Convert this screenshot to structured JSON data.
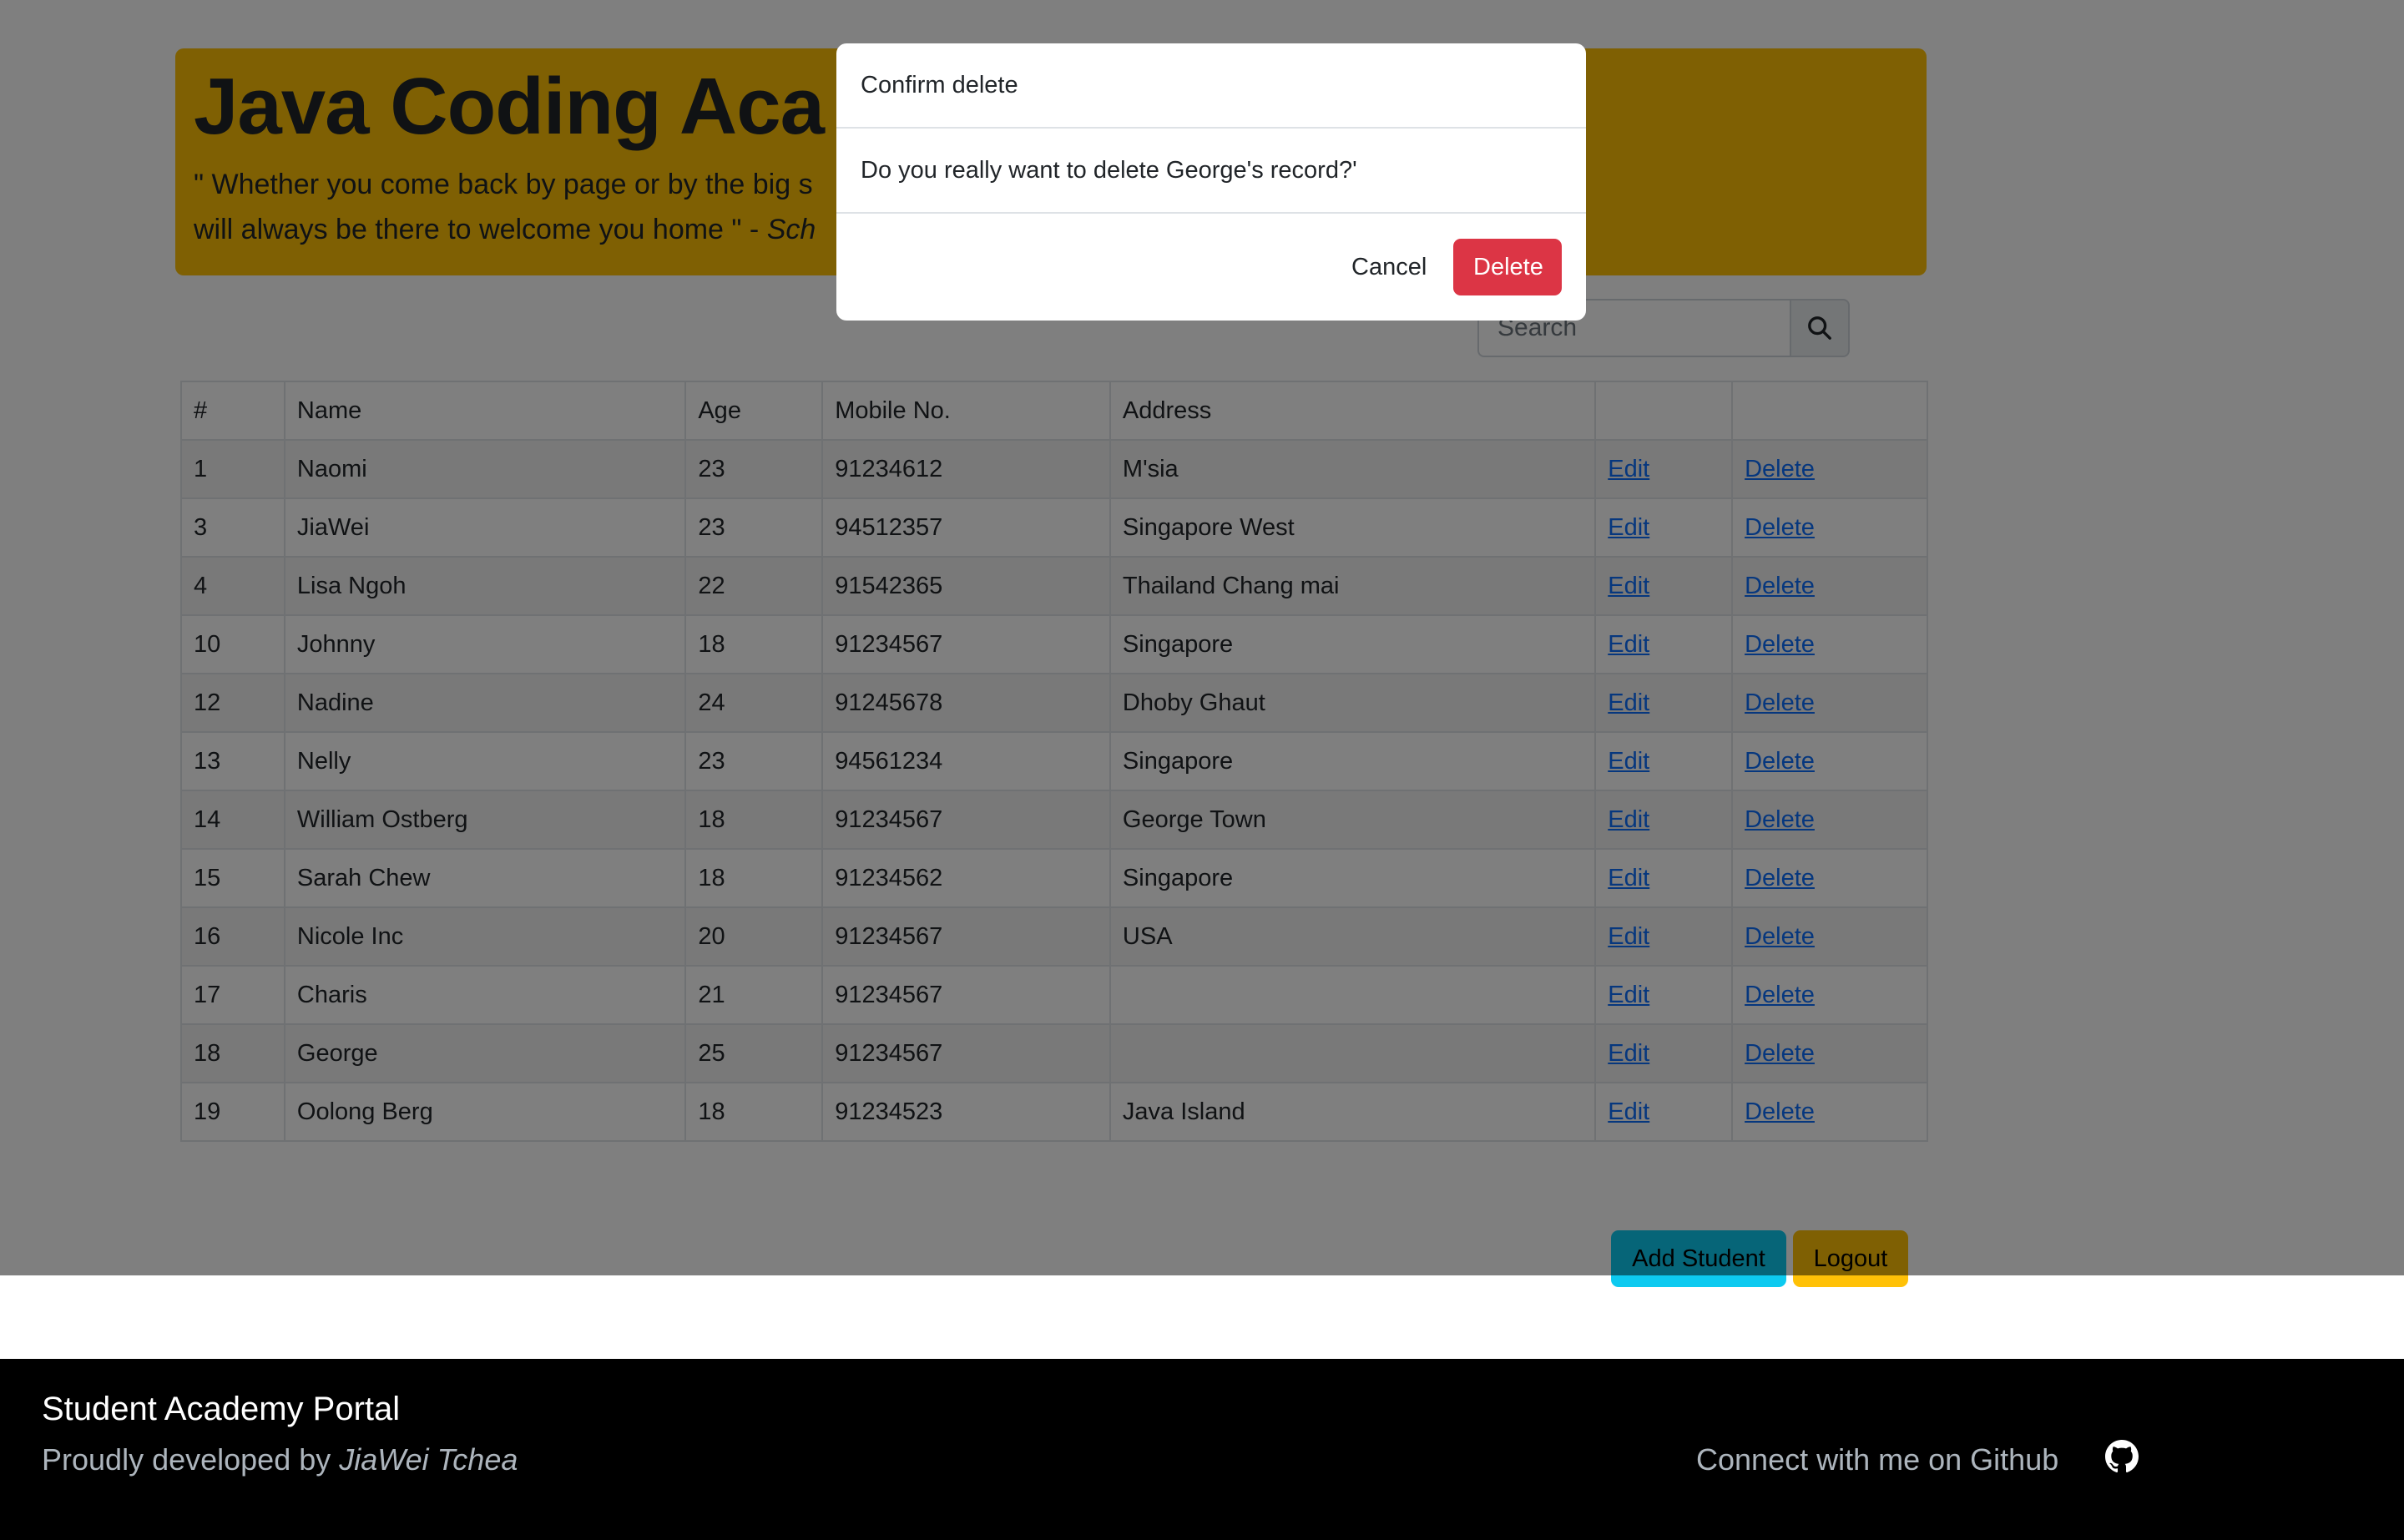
{
  "header": {
    "title": "Java Coding Aca",
    "quote_line1": "\" Whether you come back by page or by the big s",
    "quote_line2": "will always be there to welcome you home \" - ",
    "quote_author": "Sch"
  },
  "search": {
    "placeholder": "Search",
    "icon": "search-icon"
  },
  "table": {
    "columns": [
      "#",
      "Name",
      "Age",
      "Mobile No.",
      "Address",
      "",
      ""
    ],
    "rows": [
      {
        "id": "1",
        "name": "Naomi",
        "age": "23",
        "mobile": "91234612",
        "address": "M'sia",
        "edit": "Edit",
        "delete": "Delete"
      },
      {
        "id": "3",
        "name": "JiaWei",
        "age": "23",
        "mobile": "94512357",
        "address": "Singapore West",
        "edit": "Edit",
        "delete": "Delete"
      },
      {
        "id": "4",
        "name": "Lisa Ngoh",
        "age": "22",
        "mobile": "91542365",
        "address": "Thailand Chang mai",
        "edit": "Edit",
        "delete": "Delete"
      },
      {
        "id": "10",
        "name": "Johnny",
        "age": "18",
        "mobile": "91234567",
        "address": "Singapore",
        "edit": "Edit",
        "delete": "Delete"
      },
      {
        "id": "12",
        "name": "Nadine",
        "age": "24",
        "mobile": "91245678",
        "address": "Dhoby Ghaut",
        "edit": "Edit",
        "delete": "Delete"
      },
      {
        "id": "13",
        "name": "Nelly",
        "age": "23",
        "mobile": "94561234",
        "address": "Singapore",
        "edit": "Edit",
        "delete": "Delete"
      },
      {
        "id": "14",
        "name": "William Ostberg",
        "age": "18",
        "mobile": "91234567",
        "address": "George Town",
        "edit": "Edit",
        "delete": "Delete"
      },
      {
        "id": "15",
        "name": "Sarah Chew",
        "age": "18",
        "mobile": "91234562",
        "address": "Singapore",
        "edit": "Edit",
        "delete": "Delete"
      },
      {
        "id": "16",
        "name": "Nicole Inc",
        "age": "20",
        "mobile": "91234567",
        "address": "USA",
        "edit": "Edit",
        "delete": "Delete"
      },
      {
        "id": "17",
        "name": "Charis",
        "age": "21",
        "mobile": "91234567",
        "address": "",
        "edit": "Edit",
        "delete": "Delete"
      },
      {
        "id": "18",
        "name": "George",
        "age": "25",
        "mobile": "91234567",
        "address": "",
        "edit": "Edit",
        "delete": "Delete"
      },
      {
        "id": "19",
        "name": "Oolong Berg",
        "age": "18",
        "mobile": "91234523",
        "address": "Java Island",
        "edit": "Edit",
        "delete": "Delete"
      }
    ]
  },
  "actions": {
    "add_label": "Add Student",
    "logout_label": "Logout"
  },
  "footer": {
    "title": "Student Academy Portal",
    "developed_prefix": "Proudly developed by ",
    "developer": "JiaWei Tchea",
    "connect": "Connect with me on Github",
    "icon": "github-icon"
  },
  "modal": {
    "title": "Confirm delete",
    "message": "Do you really want to delete George's record?'",
    "cancel_label": "Cancel",
    "delete_label": "Delete"
  },
  "colors": {
    "jumbotron": "#ffc107",
    "info_button": "#0dcaf0",
    "warning_button": "#ffc107",
    "danger_button": "#dc3545",
    "link": "#0d6efd",
    "footer_bg": "#000000"
  }
}
